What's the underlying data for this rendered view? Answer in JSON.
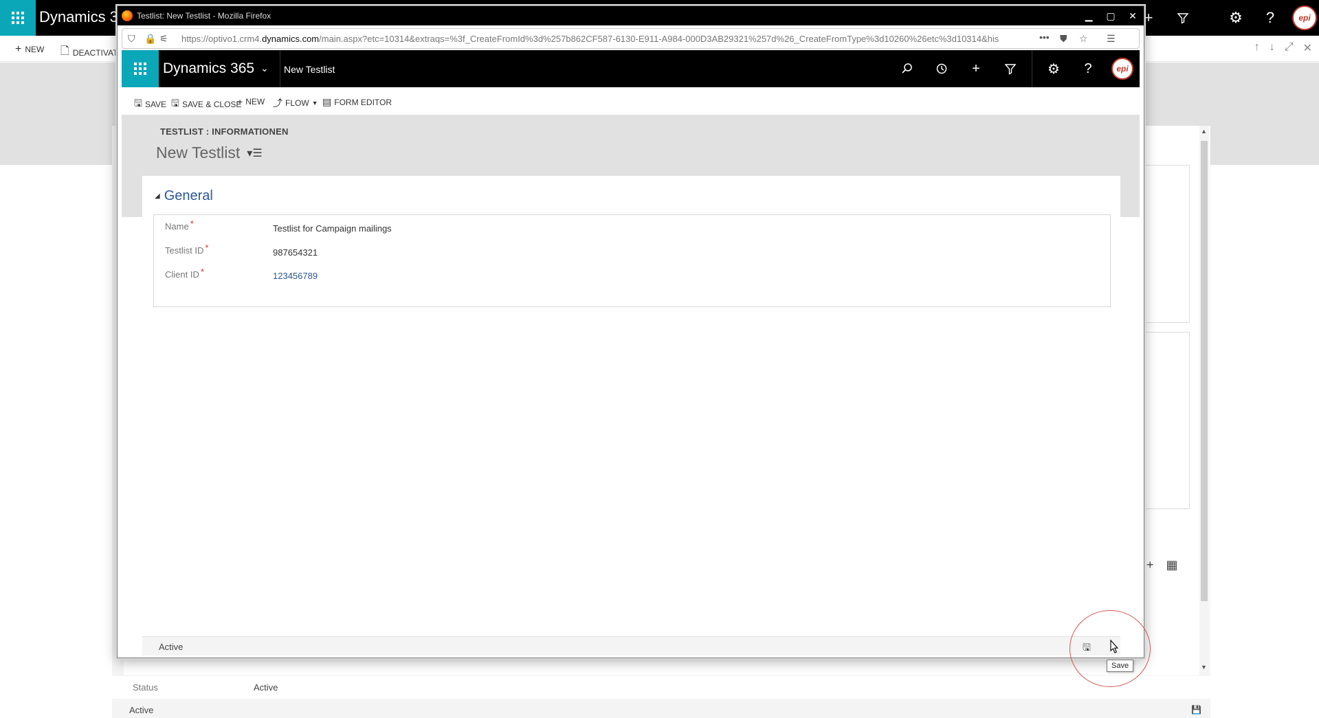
{
  "background": {
    "app_name": "Dynamics 365",
    "commands": {
      "new": "NEW",
      "deactivate": "DEACTIVAT"
    },
    "status_label": "Status",
    "status_value": "Active",
    "footer_status": "Active"
  },
  "popup": {
    "window_title": "Testlist: New Testlist - Mozilla Firefox",
    "url": {
      "prefix": "https://optivo1.crm4.",
      "domain": "dynamics.com",
      "rest": "/main.aspx?etc=10314&extraqs=%3f_CreateFromId%3d%257b862CF587-6130-E911-A984-000D3AB29321%257d%26_CreateFromType%3d10260%26etc%3d10314&his"
    },
    "app": {
      "name": "Dynamics 365",
      "breadcrumb": "New Testlist"
    },
    "commands": {
      "save": "SAVE",
      "save_close": "SAVE & CLOSE",
      "new": "NEW",
      "flow": "FLOW",
      "form_editor": "FORM EDITOR"
    },
    "header": {
      "entity_form": "TESTLIST : INFORMATIONEN",
      "record_title": "New Testlist"
    },
    "section": {
      "title": "General"
    },
    "fields": [
      {
        "label": "Name",
        "value": "Testlist for Campaign mailings",
        "link": false
      },
      {
        "label": "Testlist ID",
        "value": "987654321",
        "link": false
      },
      {
        "label": "Client ID",
        "value": "123456789",
        "link": true
      }
    ],
    "footer": {
      "status": "Active"
    }
  },
  "overlay": {
    "tooltip": "Save"
  },
  "colors": {
    "teal": "#0aa7b8",
    "link": "#2b5797",
    "required": "#e03030",
    "highlight": "#d9534f"
  }
}
